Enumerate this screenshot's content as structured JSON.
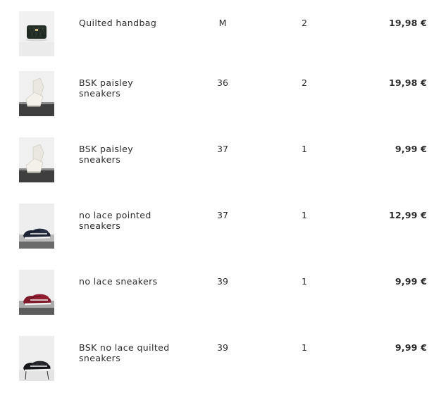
{
  "colors": {
    "text": "#2b2b2b",
    "background": "#ffffff"
  },
  "items": [
    {
      "name": "Quilted handbag",
      "size": "M",
      "quantity": "2",
      "price": "19,98 €",
      "image": "quilted-handbag-image"
    },
    {
      "name": "BSK paisley sneakers",
      "size": "36",
      "quantity": "2",
      "price": "19,98 €",
      "image": "white-sneakers-image"
    },
    {
      "name": "BSK paisley sneakers",
      "size": "37",
      "quantity": "1",
      "price": "9,99 €",
      "image": "white-sneakers-image"
    },
    {
      "name": "no lace pointed sneakers",
      "size": "37",
      "quantity": "1",
      "price": "12,99 €",
      "image": "navy-slip-on-image"
    },
    {
      "name": "no lace sneakers",
      "size": "39",
      "quantity": "1",
      "price": "9,99 €",
      "image": "burgundy-slip-on-image"
    },
    {
      "name": "BSK no lace quilted sneakers",
      "size": "39",
      "quantity": "1",
      "price": "9,99 €",
      "image": "black-quilted-slip-on-image"
    }
  ]
}
